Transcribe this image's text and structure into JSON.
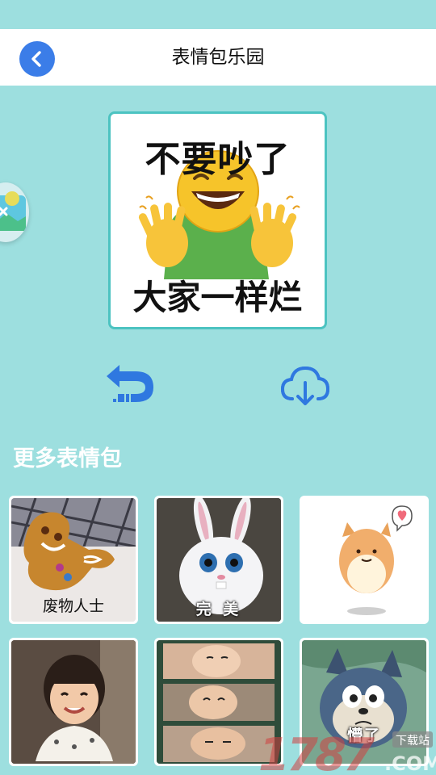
{
  "header": {
    "title": "表情包乐园"
  },
  "preview": {
    "top_text": "不要吵了",
    "bottom_text": "大家一样烂"
  },
  "section": {
    "title": "更多表情包"
  },
  "stickers": [
    {
      "caption": "废物人士"
    },
    {
      "caption": "完 美"
    },
    {
      "caption": ""
    },
    {
      "caption": ""
    },
    {
      "caption": ""
    },
    {
      "caption": "懵了"
    }
  ],
  "watermark": {
    "number": "1787",
    "suffix": "下载站",
    "domain": ".COM"
  },
  "colors": {
    "background": "#9ddfdf",
    "accent_blue": "#3b7de8",
    "border_teal": "#4cc3c1"
  }
}
